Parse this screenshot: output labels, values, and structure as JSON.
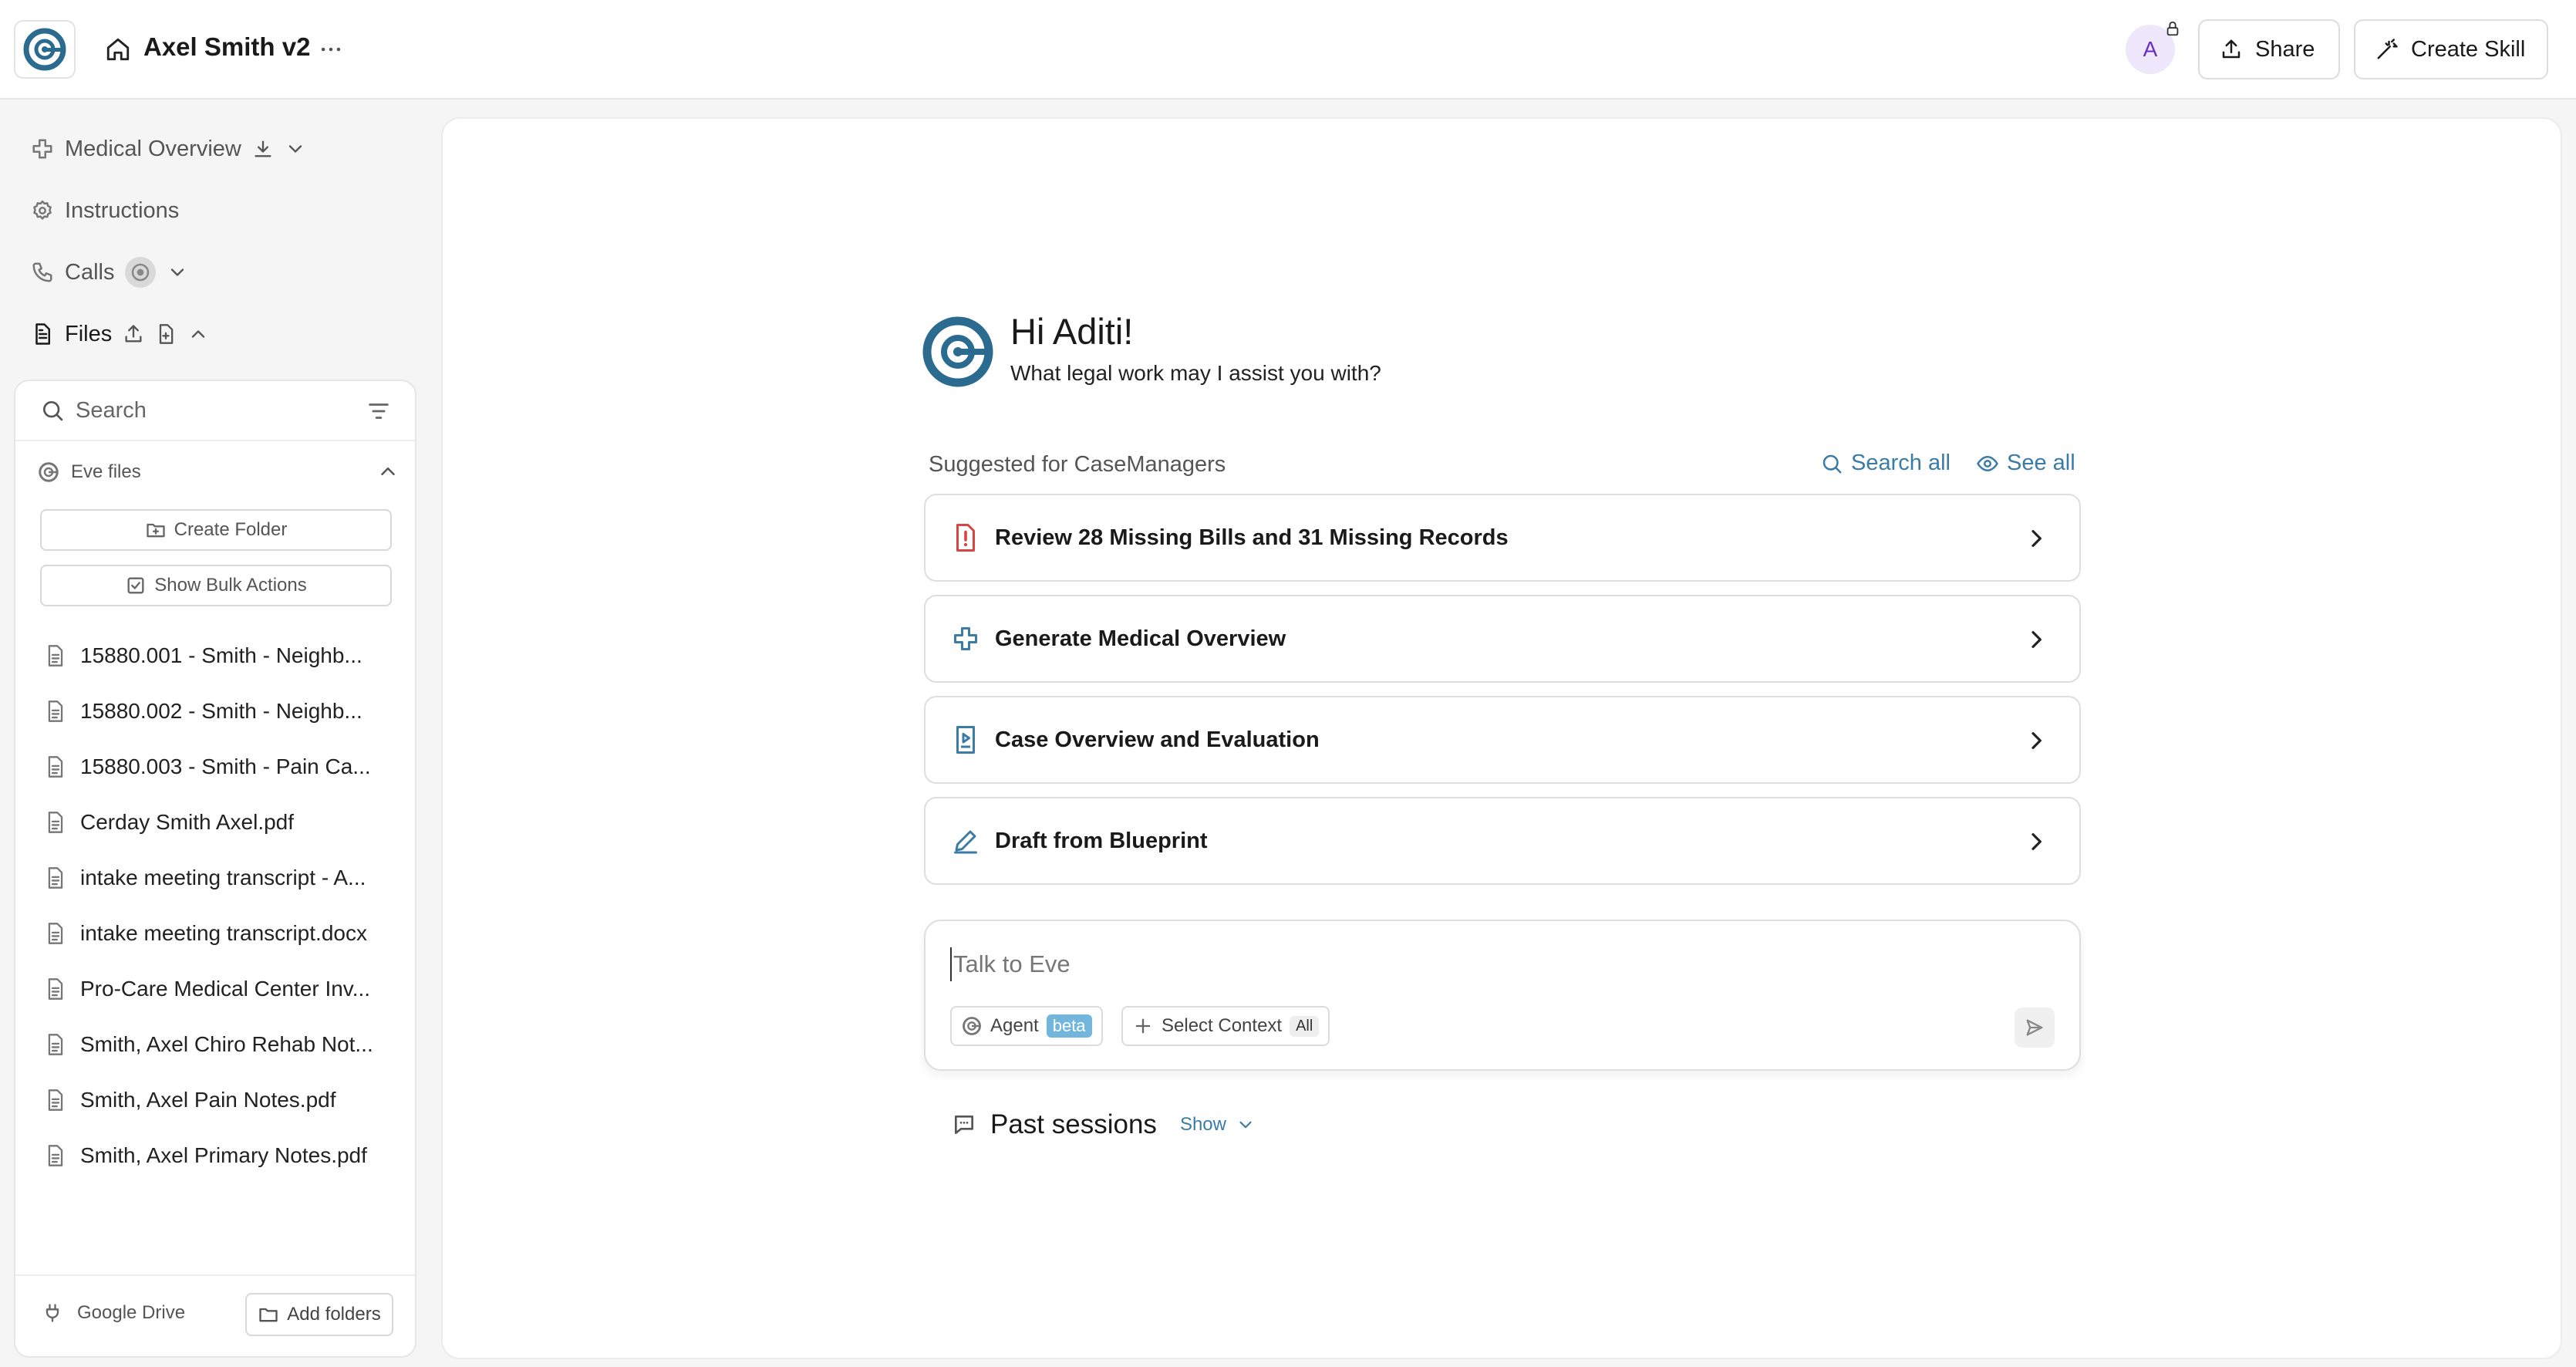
{
  "header": {
    "title": "Axel Smith v2",
    "avatar_initial": "A",
    "share_label": "Share",
    "create_skill_label": "Create Skill"
  },
  "sidebar": {
    "nav": {
      "medical_overview": "Medical Overview",
      "instructions": "Instructions",
      "calls": "Calls",
      "files": "Files"
    },
    "files_panel": {
      "search_placeholder": "Search",
      "section_label": "Eve files",
      "create_folder_label": "Create Folder",
      "bulk_actions_label": "Show Bulk Actions",
      "files": [
        "15880.001 - Smith - Neighb...",
        "15880.002 - Smith - Neighb...",
        "15880.003 - Smith - Pain Ca...",
        "Cerday Smith Axel.pdf",
        "intake meeting transcript - A...",
        "intake meeting transcript.docx",
        "Pro-Care Medical Center Inv...",
        "Smith, Axel Chiro Rehab Not...",
        "Smith, Axel Pain Notes.pdf",
        "Smith, Axel Primary Notes.pdf"
      ],
      "google_drive_label": "Google Drive",
      "add_folders_label": "Add folders"
    }
  },
  "main": {
    "greeting": "Hi Aditi!",
    "subtitle": "What legal work may I assist you with?",
    "suggested_label": "Suggested for CaseManagers",
    "search_all_label": "Search all",
    "see_all_label": "See all",
    "cards": [
      {
        "label": "Review 28 Missing Bills and 31 Missing Records",
        "icon": "alert-file-icon"
      },
      {
        "label": "Generate Medical Overview",
        "icon": "medical-cross-icon"
      },
      {
        "label": "Case Overview and Evaluation",
        "icon": "presentation-icon"
      },
      {
        "label": "Draft from Blueprint",
        "icon": "pencil-icon"
      }
    ],
    "chat": {
      "placeholder": "Talk to Eve",
      "agent_label": "Agent",
      "beta_label": "beta",
      "select_context_label": "Select Context",
      "all_label": "All"
    },
    "past_sessions_label": "Past sessions",
    "show_label": "Show"
  },
  "colors": {
    "brand": "#2b6b8f",
    "link": "#3a7ca5",
    "alert": "#d64541",
    "beta_pill": "#73b6dd",
    "avatar_bg": "#efe7fb",
    "avatar_text": "#6a2fc2"
  }
}
